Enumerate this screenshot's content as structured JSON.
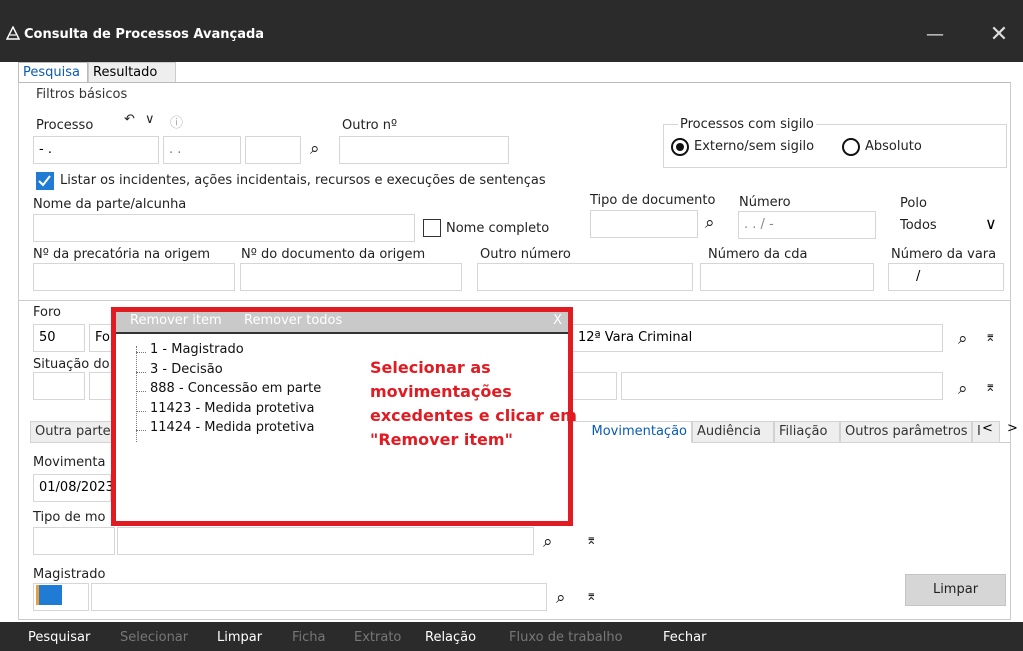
{
  "window": {
    "title": "Consulta de Processos Avançada",
    "minimize": "—",
    "close": "✕"
  },
  "top_tabs": [
    {
      "label": "Pesquisa",
      "active": true
    },
    {
      "label": "Resultado",
      "active": false
    }
  ],
  "filtros": {
    "group_title": "Filtros básicos",
    "processo_label": "Processo",
    "processo_value": "-  .",
    "processo_value2": ".  .",
    "outro_no_label": "Outro nº",
    "sigilo_label": "Processos com sigilo",
    "sigilo_options": [
      {
        "label": "Externo/sem sigilo",
        "selected": true
      },
      {
        "label": "Absoluto",
        "selected": false
      }
    ],
    "listar_incidentes_label": "Listar os incidentes, ações incidentais, recursos e execuções de sentenças",
    "nome_parte_label": "Nome da parte/alcunha",
    "nome_completo_label": "Nome completo",
    "tipo_documento_label": "Tipo de documento",
    "numero_label": "Número",
    "numero_value": ".  .  /  -",
    "polo_label": "Polo",
    "polo_value": "Todos",
    "precatoria_label": "Nº da precatória na origem",
    "doc_origem_label": "Nº do documento da origem",
    "outro_numero_label": "Outro número",
    "cda_label": "Número da cda",
    "vara_label": "Número da vara",
    "vara_value": "/",
    "foro_label": "Foro",
    "foro_code": "50",
    "foro_name_partial": "Fo",
    "vara_name": "12ª Vara Criminal",
    "situacao_label_partial": "Situação do"
  },
  "bottom_tabs": [
    {
      "label": "Outra parte",
      "active": false
    },
    {
      "label": "Movimentação",
      "active": true
    },
    {
      "label": "Audiência",
      "active": false
    },
    {
      "label": "Filiação",
      "active": false
    },
    {
      "label": "Outros parâmetros",
      "active": false
    }
  ],
  "movimentacao": {
    "mov_label_partial": "Movimenta",
    "date_partial": "01/08/2023",
    "tipo_label_partial": "Tipo de mo",
    "magistrado_label": "Magistrado",
    "limpar_label": "Limpar"
  },
  "popup": {
    "remove_item": "Remover item",
    "remove_all": "Remover todos",
    "close": "X",
    "items": [
      "1 - Magistrado",
      "3 - Decisão",
      "888 - Concessão em parte",
      "11423 - Medida protetiva",
      "11424 - Medida protetiva"
    ],
    "annotation": "Selecionar as movimentações excedentes e clicar em \"Remover item\""
  },
  "statusbar": [
    {
      "label": "Pesquisar",
      "enabled": true
    },
    {
      "label": "Selecionar",
      "enabled": false
    },
    {
      "label": "Limpar",
      "enabled": true
    },
    {
      "label": "Ficha",
      "enabled": false
    },
    {
      "label": "Extrato",
      "enabled": false
    },
    {
      "label": "Relação",
      "enabled": true
    },
    {
      "label": "Fluxo de trabalho",
      "enabled": false
    },
    {
      "label": "Fechar",
      "enabled": true
    }
  ],
  "colors": {
    "titlebar": "#2b2b2b",
    "accent": "#1f7bd3",
    "annotation_red": "#e11b22",
    "tab_active_text": "#0a5bb5"
  }
}
